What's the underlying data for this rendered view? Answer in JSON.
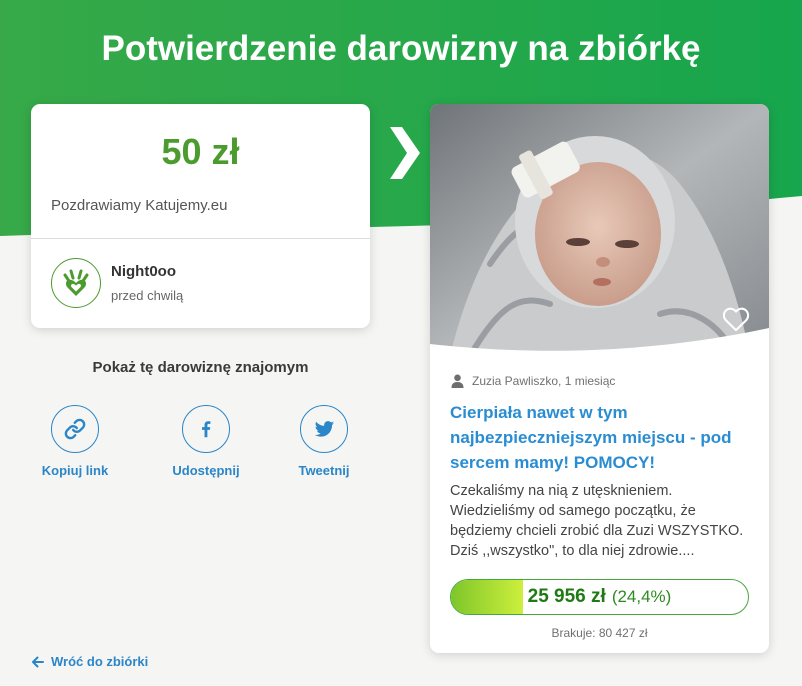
{
  "page": {
    "title": "Potwierdzenie darowizny na zbiórkę"
  },
  "colors": {
    "header_green_left": "#37a948",
    "header_green_right": "#17a64d",
    "amount_green": "#4b9b2f",
    "link_blue": "#2a86c8",
    "title_blue": "#2a8dd2",
    "progress_border": "#46a83c",
    "progress_fill_start": "#7ec62a",
    "progress_fill_end": "#cdef3c",
    "progress_text": "#1f7a14"
  },
  "donation": {
    "amount": "50 zł",
    "message": "Pozdrawiamy Katujemy.eu",
    "donor_name": "Night0oo",
    "time": "przed chwilą",
    "avatar_icon": "hand-heart-icon"
  },
  "share": {
    "heading": "Pokaż tę darowiznę znajomym",
    "buttons": [
      {
        "label": "Kopiuj link",
        "icon": "link-icon"
      },
      {
        "label": "Udostępnij",
        "icon": "facebook-icon"
      },
      {
        "label": "Tweetnij",
        "icon": "twitter-icon"
      }
    ]
  },
  "back_link": {
    "label": "Wróć do zbiórki",
    "icon": "arrow-left-icon"
  },
  "campaign": {
    "author_icon": "user-icon",
    "author": "Zuzia Pawliszko, 1 miesiąc",
    "favorite_icon": "heart-outline-icon",
    "title": "Cierpiała nawet w tym najbezpieczniejszym miejscu - pod sercem mamy! POMOCY!",
    "description": "Czekaliśmy na nią z utęsknieniem. Wiedzieliśmy od samego początku, że będziemy chcieli zrobić dla Zuzi WSZYSTKO. Dziś ,,wszystko\", to dla niej zdrowie....",
    "raised": "25 956 zł",
    "percent_label": "(24,4%)",
    "progress": 0.244,
    "missing": "Brakuje: 80 427 zł"
  }
}
